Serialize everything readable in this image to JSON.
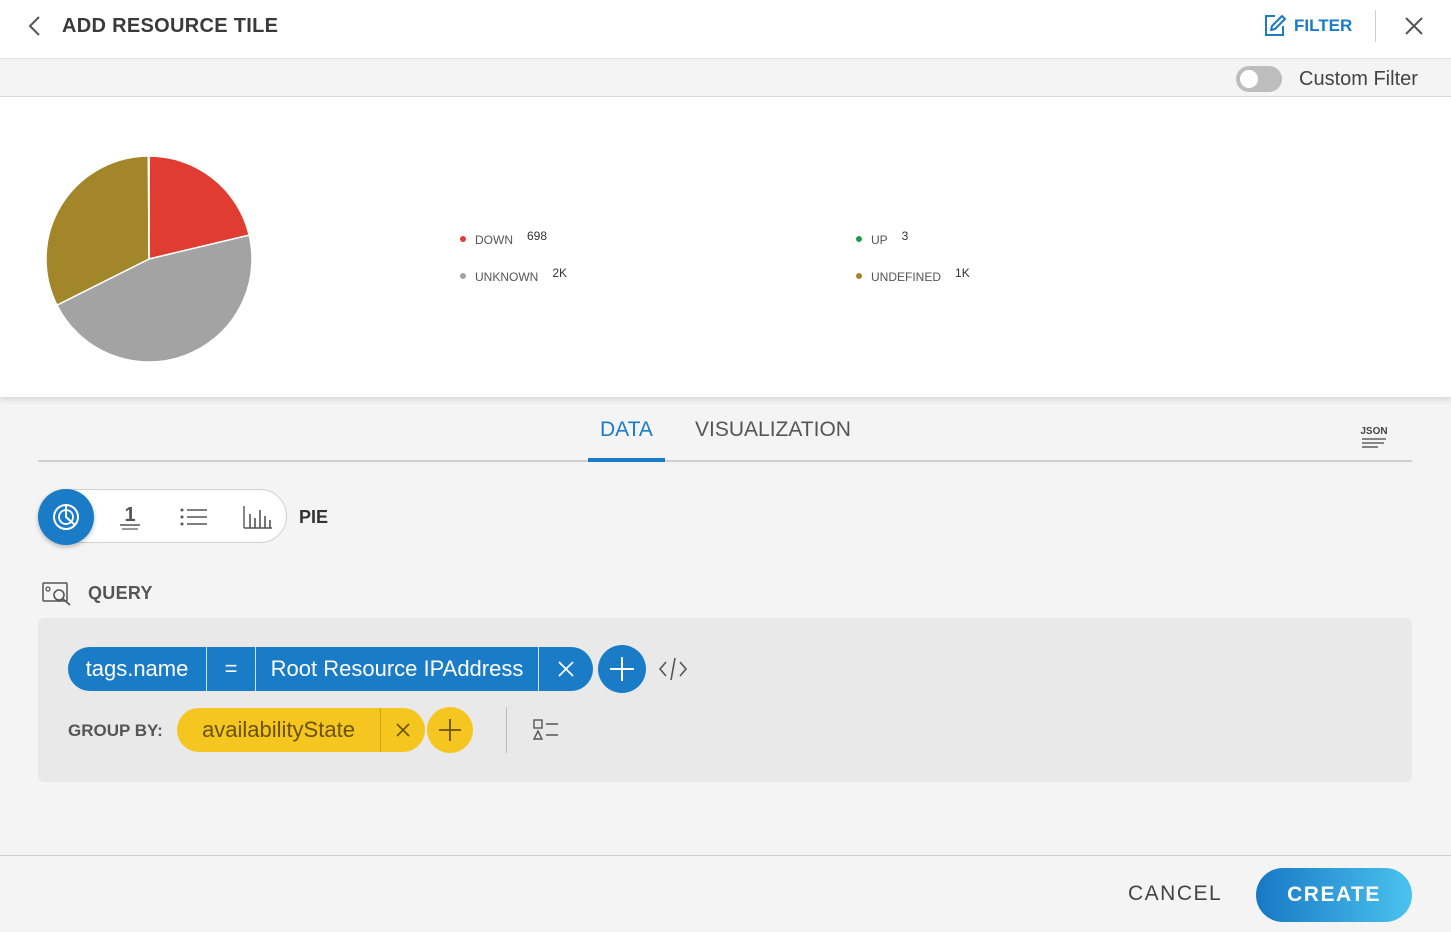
{
  "header": {
    "title": "ADD RESOURCE TILE",
    "filter_label": "FILTER",
    "icons": {
      "back": "chevron-left-icon",
      "filter": "edit-icon",
      "close": "close-icon"
    }
  },
  "filter_bar": {
    "custom_filter_label": "Custom Filter",
    "custom_filter_enabled": false
  },
  "chart_data": {
    "type": "pie",
    "slices": [
      {
        "label": "DOWN",
        "display": "698",
        "value": 698,
        "color": "#e03c31"
      },
      {
        "label": "UNKNOWN",
        "display": "2K",
        "value": 1520,
        "color": "#a3a3a3"
      },
      {
        "label": "UNDEFINED",
        "display": "1K",
        "value": 1060,
        "color": "#a38629"
      },
      {
        "label": "UP",
        "display": "3",
        "value": 3,
        "color": "#1e9e4a"
      }
    ],
    "legend_order": [
      "DOWN",
      "UP",
      "UNKNOWN",
      "UNDEFINED"
    ]
  },
  "tabs": [
    {
      "label": "DATA",
      "active": true
    },
    {
      "label": "VISUALIZATION",
      "active": false
    }
  ],
  "json_icon_label": "JSON",
  "visualization": {
    "selected_label": "PIE",
    "options": [
      "pie-chart-icon",
      "single-value-icon",
      "list-icon",
      "bar-chart-icon"
    ],
    "single_value_glyph": "1"
  },
  "query": {
    "label": "QUERY",
    "filter_chip": {
      "field": "tags.name",
      "operator": "=",
      "value": "Root Resource IPAddress"
    },
    "group_by_label": "GROUP BY:",
    "group_by_chip": {
      "value": "availabilityState"
    }
  },
  "footer": {
    "cancel_label": "CANCEL",
    "create_label": "CREATE"
  }
}
